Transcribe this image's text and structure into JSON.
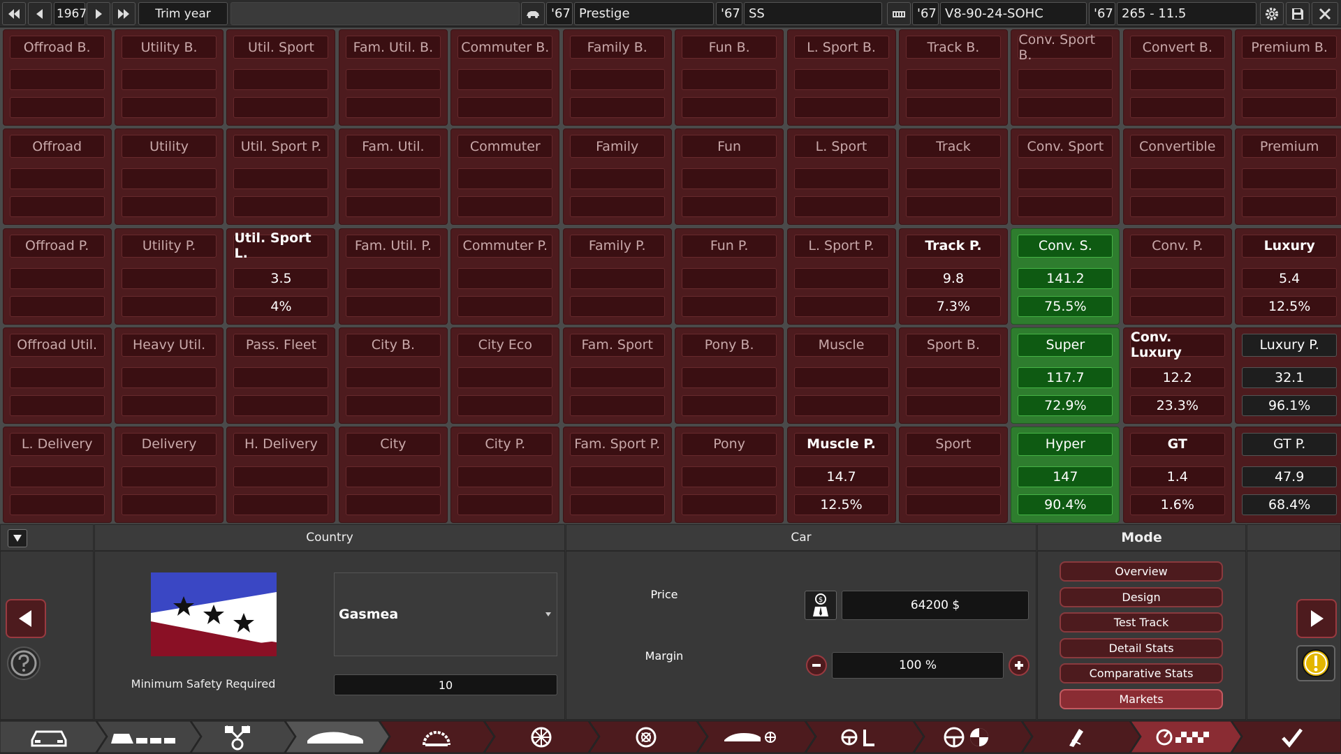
{
  "topbar": {
    "year": "1967",
    "trim_year_label": "Trim year",
    "model_year": "'67",
    "model_name": "Prestige",
    "trim_year": "'67",
    "trim_name": "SS",
    "engine_year": "'67",
    "engine_name": "V8-90-24-SOHC",
    "variant_year": "'67",
    "variant_name": "265 - 11.5"
  },
  "grid": [
    [
      {
        "label": "Offroad B.",
        "v1": "",
        "v2": ""
      },
      {
        "label": "Utility B.",
        "v1": "",
        "v2": ""
      },
      {
        "label": "Util. Sport",
        "v1": "",
        "v2": ""
      },
      {
        "label": "Fam. Util. B.",
        "v1": "",
        "v2": ""
      },
      {
        "label": "Commuter B.",
        "v1": "",
        "v2": ""
      },
      {
        "label": "Family B.",
        "v1": "",
        "v2": ""
      },
      {
        "label": "Fun B.",
        "v1": "",
        "v2": ""
      },
      {
        "label": "L. Sport B.",
        "v1": "",
        "v2": ""
      },
      {
        "label": "Track B.",
        "v1": "",
        "v2": ""
      },
      {
        "label": "Conv. Sport B.",
        "v1": "",
        "v2": ""
      },
      {
        "label": "Convert B.",
        "v1": "",
        "v2": ""
      },
      {
        "label": "Premium B.",
        "v1": "",
        "v2": ""
      }
    ],
    [
      {
        "label": "Offroad",
        "v1": "",
        "v2": ""
      },
      {
        "label": "Utility",
        "v1": "",
        "v2": ""
      },
      {
        "label": "Util. Sport P.",
        "v1": "",
        "v2": ""
      },
      {
        "label": "Fam. Util.",
        "v1": "",
        "v2": ""
      },
      {
        "label": "Commuter",
        "v1": "",
        "v2": ""
      },
      {
        "label": "Family",
        "v1": "",
        "v2": ""
      },
      {
        "label": "Fun",
        "v1": "",
        "v2": ""
      },
      {
        "label": "L. Sport",
        "v1": "",
        "v2": ""
      },
      {
        "label": "Track",
        "v1": "",
        "v2": ""
      },
      {
        "label": "Conv. Sport",
        "v1": "",
        "v2": ""
      },
      {
        "label": "Convertible",
        "v1": "",
        "v2": ""
      },
      {
        "label": "Premium",
        "v1": "",
        "v2": ""
      }
    ],
    [
      {
        "label": "Offroad P.",
        "v1": "",
        "v2": ""
      },
      {
        "label": "Utility P.",
        "v1": "",
        "v2": ""
      },
      {
        "label": "Util. Sport L.",
        "v1": "3.5",
        "v2": "4%",
        "state": "active"
      },
      {
        "label": "Fam. Util. P.",
        "v1": "",
        "v2": ""
      },
      {
        "label": "Commuter P.",
        "v1": "",
        "v2": ""
      },
      {
        "label": "Family P.",
        "v1": "",
        "v2": ""
      },
      {
        "label": "Fun P.",
        "v1": "",
        "v2": ""
      },
      {
        "label": "L. Sport P.",
        "v1": "",
        "v2": ""
      },
      {
        "label": "Track P.",
        "v1": "9.8",
        "v2": "7.3%",
        "state": "active"
      },
      {
        "label": "Conv. S.",
        "v1": "141.2",
        "v2": "75.5%",
        "state": "green"
      },
      {
        "label": "Conv. P.",
        "v1": "",
        "v2": ""
      },
      {
        "label": "Luxury",
        "v1": "5.4",
        "v2": "12.5%",
        "state": "active"
      }
    ],
    [
      {
        "label": "Offroad Util.",
        "v1": "",
        "v2": ""
      },
      {
        "label": "Heavy Util.",
        "v1": "",
        "v2": ""
      },
      {
        "label": "Pass. Fleet",
        "v1": "",
        "v2": ""
      },
      {
        "label": "City B.",
        "v1": "",
        "v2": ""
      },
      {
        "label": "City Eco",
        "v1": "",
        "v2": ""
      },
      {
        "label": "Fam. Sport",
        "v1": "",
        "v2": ""
      },
      {
        "label": "Pony B.",
        "v1": "",
        "v2": ""
      },
      {
        "label": "Muscle",
        "v1": "",
        "v2": ""
      },
      {
        "label": "Sport B.",
        "v1": "",
        "v2": ""
      },
      {
        "label": "Super",
        "v1": "117.7",
        "v2": "72.9%",
        "state": "green"
      },
      {
        "label": "Conv. Luxury",
        "v1": "12.2",
        "v2": "23.3%",
        "state": "active"
      },
      {
        "label": "Luxury P.",
        "v1": "32.1",
        "v2": "96.1%",
        "state": "dark"
      }
    ],
    [
      {
        "label": "L. Delivery",
        "v1": "",
        "v2": ""
      },
      {
        "label": "Delivery",
        "v1": "",
        "v2": ""
      },
      {
        "label": "H. Delivery",
        "v1": "",
        "v2": ""
      },
      {
        "label": "City",
        "v1": "",
        "v2": ""
      },
      {
        "label": "City P.",
        "v1": "",
        "v2": ""
      },
      {
        "label": "Fam. Sport P.",
        "v1": "",
        "v2": ""
      },
      {
        "label": "Pony",
        "v1": "",
        "v2": ""
      },
      {
        "label": "Muscle P.",
        "v1": "14.7",
        "v2": "12.5%",
        "state": "active"
      },
      {
        "label": "Sport",
        "v1": "",
        "v2": ""
      },
      {
        "label": "Hyper",
        "v1": "147",
        "v2": "90.4%",
        "state": "green"
      },
      {
        "label": "GT",
        "v1": "1.4",
        "v2": "1.6%",
        "state": "active"
      },
      {
        "label": "GT P.",
        "v1": "47.9",
        "v2": "68.4%",
        "state": "dark"
      }
    ]
  ],
  "country": {
    "header": "Country",
    "selected": "Gasmea",
    "min_safety_label": "Minimum Safety Required",
    "min_safety_value": "10"
  },
  "car": {
    "header": "Car",
    "price_label": "Price",
    "price_value": "64200 $",
    "margin_label": "Margin",
    "margin_value": "100 %"
  },
  "mode": {
    "header": "Mode",
    "buttons": [
      "Overview",
      "Design",
      "Test Track",
      "Detail Stats",
      "Comparative Stats",
      "Markets"
    ],
    "selected": "Markets"
  },
  "colors": {
    "cell_red": "#4d1b1e",
    "cell_green": "#2e7d2e",
    "accent": "#8a2c33"
  }
}
